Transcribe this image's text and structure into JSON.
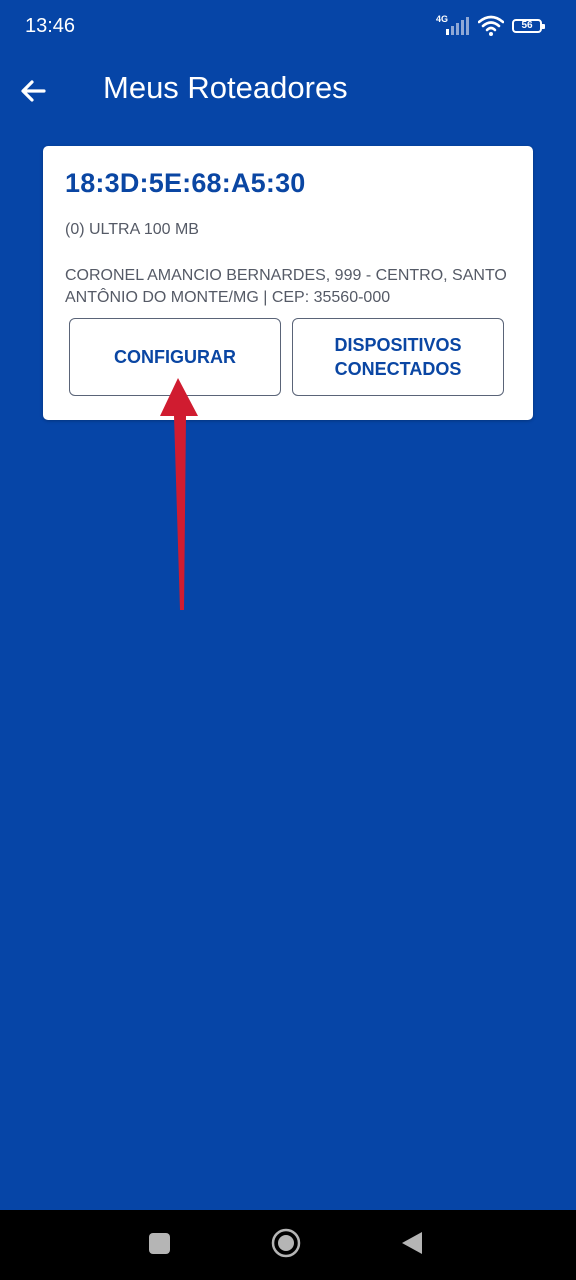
{
  "status_bar": {
    "time": "13:46",
    "network_type": "4G",
    "battery_level": "56",
    "icons": [
      "signal-icon",
      "wifi-icon",
      "battery-icon"
    ]
  },
  "app_bar": {
    "title": "Meus Roteadores",
    "back_icon": "arrow-left-icon"
  },
  "router_card": {
    "mac_address": "18:3D:5E:68:A5:30",
    "plan": "(0) ULTRA 100 MB",
    "address": "CORONEL AMANCIO BERNARDES, 999 - CENTRO, SANTO ANTÔNIO DO MONTE/MG | CEP: 35560-000",
    "buttons": {
      "configure": "CONFIGURAR",
      "devices_line1": "DISPOSITIVOS",
      "devices_line2": "CONECTADOS"
    }
  },
  "nav_bar": {
    "icons": [
      "recents-square-icon",
      "home-circle-icon",
      "back-triangle-icon"
    ]
  },
  "colors": {
    "background": "#0645a7",
    "card": "#ffffff",
    "accent_text": "#0a46a3",
    "secondary_text": "#555a66",
    "annotation_arrow": "#d01c30",
    "nav_bar": "#000000"
  }
}
